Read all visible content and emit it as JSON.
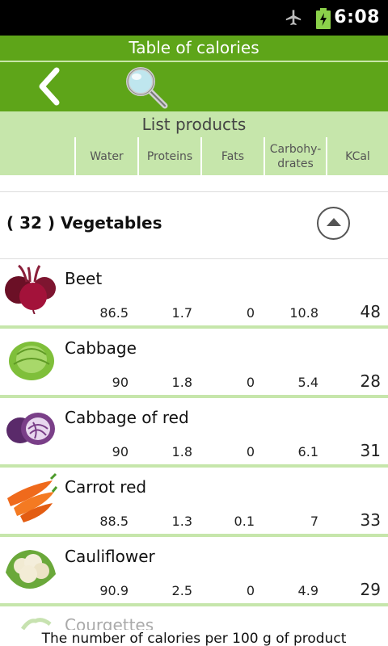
{
  "status": {
    "time": "6:08"
  },
  "header": {
    "title": "Table of calories"
  },
  "subtitle": "List products",
  "columns": {
    "water": "Water",
    "proteins": "Proteins",
    "fats": "Fats",
    "carbs_line1": "Carbohy-",
    "carbs_line2": "drates",
    "kcal": "KCal"
  },
  "group": {
    "title": "( 32 ) Vegetables"
  },
  "products": [
    {
      "name": "Beet",
      "water": "86.5",
      "proteins": "1.7",
      "fats": "0",
      "carbs": "10.8",
      "kcal": "48"
    },
    {
      "name": "Cabbage",
      "water": "90",
      "proteins": "1.8",
      "fats": "0",
      "carbs": "5.4",
      "kcal": "28"
    },
    {
      "name": "Cabbage of red",
      "water": "90",
      "proteins": "1.8",
      "fats": "0",
      "carbs": "6.1",
      "kcal": "31"
    },
    {
      "name": "Carrot red",
      "water": "88.5",
      "proteins": "1.3",
      "fats": "0.1",
      "carbs": "7",
      "kcal": "33"
    },
    {
      "name": "Cauliflower",
      "water": "90.9",
      "proteins": "2.5",
      "fats": "0",
      "carbs": "4.9",
      "kcal": "29"
    }
  ],
  "partial_item": {
    "name": "Courgettes"
  },
  "footer": "The number of calories per 100 g of product",
  "colors": {
    "accent": "#5ea519",
    "light": "#c6e6ab"
  },
  "icons": {
    "back": "chevron-left-icon",
    "search": "magnifier-icon",
    "collapse": "chevron-up-icon",
    "airplane": "airplane-icon",
    "battery": "battery-charging-icon"
  }
}
